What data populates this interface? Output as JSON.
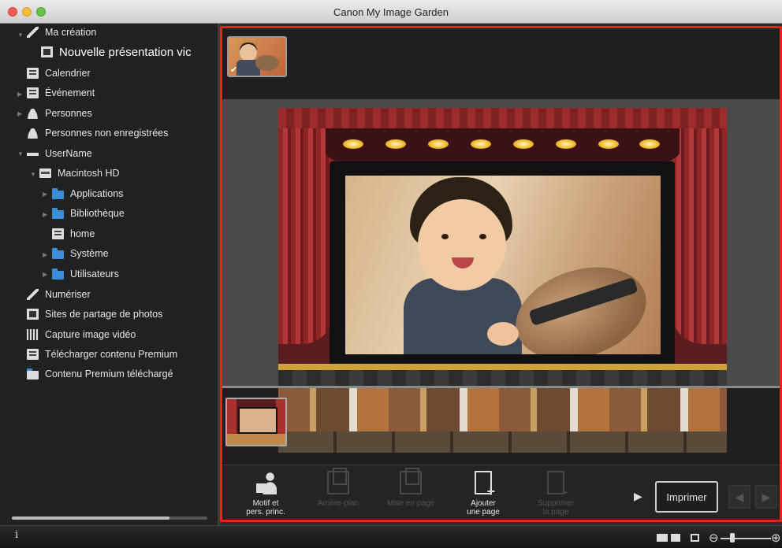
{
  "window": {
    "title": "Canon My Image Garden"
  },
  "sidebar": {
    "items": [
      {
        "label": "Ma création"
      },
      {
        "label": "Nouvelle présentation vic"
      },
      {
        "label": "Calendrier"
      },
      {
        "label": "Événement"
      },
      {
        "label": "Personnes"
      },
      {
        "label": "Personnes non enregistrées"
      },
      {
        "label": "UserName"
      },
      {
        "label": "Macintosh HD"
      },
      {
        "label": "Applications"
      },
      {
        "label": "Bibliothèque"
      },
      {
        "label": "home"
      },
      {
        "label": "Système"
      },
      {
        "label": "Utilisateurs"
      },
      {
        "label": "Numériser"
      },
      {
        "label": "Sites de partage de photos"
      },
      {
        "label": "Capture image vidéo"
      },
      {
        "label": "Télécharger contenu Premium"
      },
      {
        "label": "Contenu Premium téléchargé"
      }
    ]
  },
  "toolbar": {
    "motif_label_1": "Motif et",
    "motif_label_2": "pers. princ.",
    "background_label": "Arrière-plan",
    "layout_label": "Mise en page",
    "add_page_label_1": "Ajouter",
    "add_page_label_2": "une page",
    "delete_page_label_1": "Supprimer",
    "delete_page_label_2": "la page",
    "print_label": "Imprimer"
  },
  "colors": {
    "highlight_frame": "#e8231d",
    "folder": "#3a8fd8"
  }
}
